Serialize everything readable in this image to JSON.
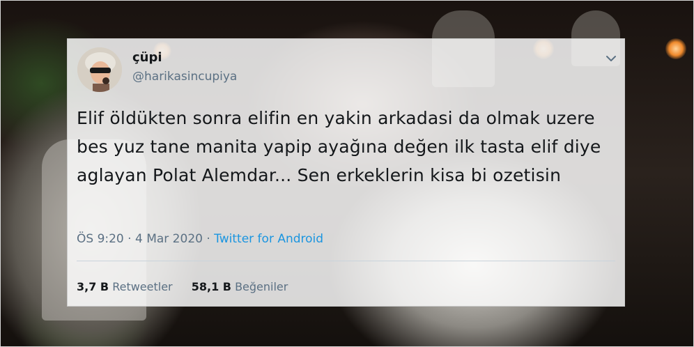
{
  "tweet": {
    "display_name": "çüpi",
    "handle": "@harikasincupiya",
    "text": "Elif öldükten sonra elifin en yakin arkadasi da olmak uzere bes yuz tane manita yapip ayağına değen ilk tasta elif diye aglayan Polat Alemdar... Sen erkeklerin kisa bi ozetisin",
    "time": "ÖS 9:20",
    "separator": "·",
    "date": "4 Mar 2020",
    "source": "Twitter for Android",
    "retweets": {
      "count": "3,7 B",
      "label": "Retweetler"
    },
    "likes": {
      "count": "58,1 B",
      "label": "Beğeniler"
    }
  },
  "icons": {
    "menu": "chevron-down-icon",
    "avatar": "profile-picture"
  },
  "colors": {
    "text": "#14171a",
    "secondary": "#5b7083",
    "link": "#1b95e0"
  }
}
